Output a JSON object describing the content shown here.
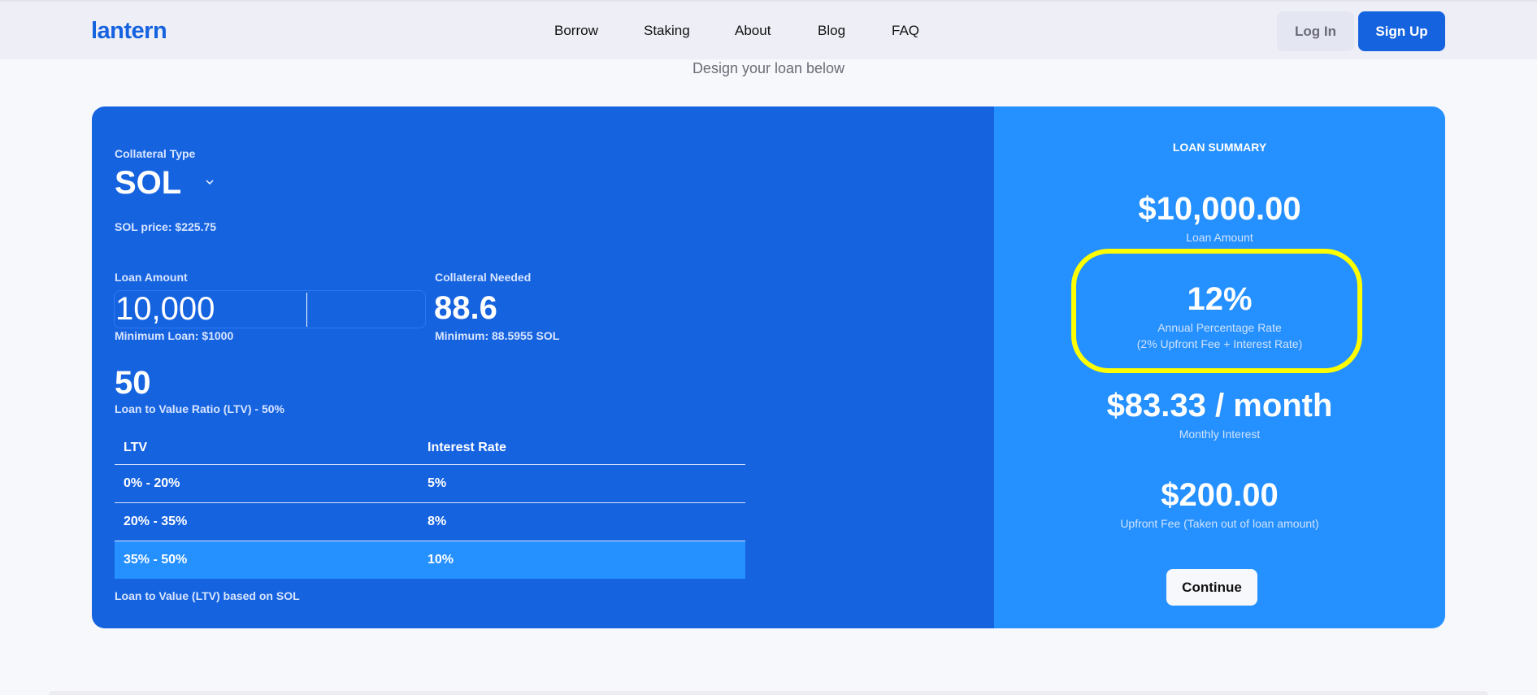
{
  "header": {
    "logo": "lantern",
    "nav": [
      {
        "label": "Borrow"
      },
      {
        "label": "Staking"
      },
      {
        "label": "About"
      },
      {
        "label": "Blog"
      },
      {
        "label": "FAQ"
      }
    ],
    "login_label": "Log In",
    "signup_label": "Sign Up"
  },
  "subtitle": "Design your loan below",
  "form": {
    "collateral_type_label": "Collateral Type",
    "collateral_type_value": "SOL",
    "price_text": "SOL price: $225.75",
    "loan_amount_label": "Loan Amount",
    "loan_amount_value": "10,000",
    "min_loan_text": "Minimum Loan: $1000",
    "collateral_needed_label": "Collateral Needed",
    "collateral_needed_value": "88.6",
    "collateral_min_text": "Minimum: 88.5955 SOL",
    "ltv_value": "50",
    "ltv_label": "Loan to Value Ratio (LTV) - 50%",
    "table": {
      "headers": [
        "LTV",
        "Interest Rate"
      ],
      "rows": [
        {
          "ltv": "0% - 20%",
          "rate": "5%",
          "active": false
        },
        {
          "ltv": "20% - 35%",
          "rate": "8%",
          "active": false
        },
        {
          "ltv": "35% - 50%",
          "rate": "10%",
          "active": true
        }
      ]
    },
    "footnote": "Loan to Value (LTV) based on SOL"
  },
  "summary": {
    "title": "LOAN SUMMARY",
    "loan_amount_value": "$10,000.00",
    "loan_amount_label": "Loan Amount",
    "apr_value": "12%",
    "apr_label": "Annual Percentage Rate",
    "apr_sublabel": "(2% Upfront Fee + Interest Rate)",
    "monthly_value": "$83.33 / month",
    "monthly_label": "Monthly Interest",
    "fee_value": "$200.00",
    "fee_label": "Upfront Fee (Taken out of loan amount)",
    "continue_label": "Continue"
  },
  "colors": {
    "brand": "#1663e0",
    "summary_bg": "#2590ff",
    "highlight": "#ffff00"
  }
}
